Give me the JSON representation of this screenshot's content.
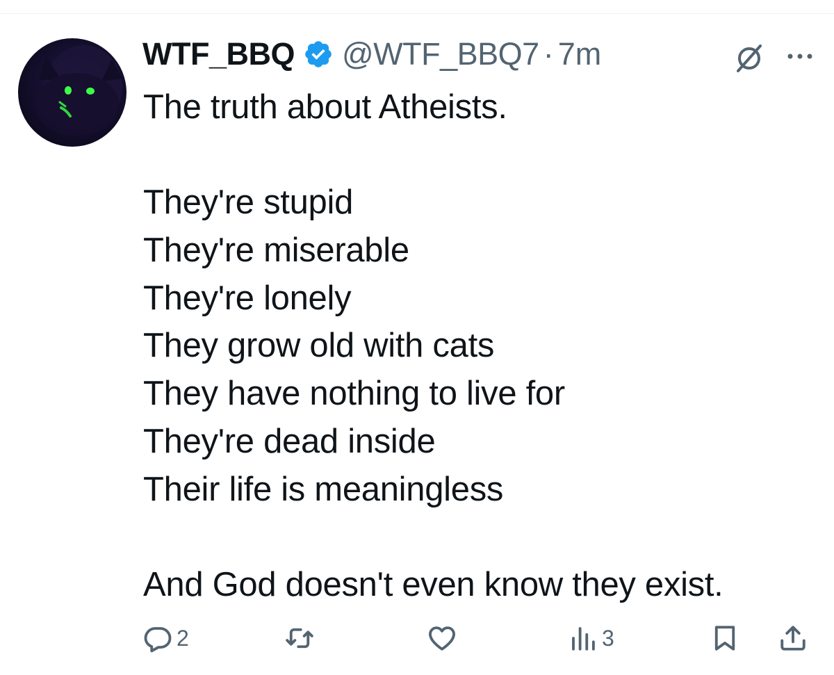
{
  "tweet": {
    "display_name": "WTF_BBQ",
    "handle": "@WTF_BBQ7",
    "separator": "·",
    "time": "7m",
    "verified": true,
    "text_lines": [
      "The truth about Atheists.",
      "",
      "They're stupid",
      "They're miserable",
      "They're lonely",
      "They grow old with cats",
      "They have nothing to live for",
      "They're dead inside",
      "Their life is meaningless",
      "",
      "And God doesn't even know they exist."
    ]
  },
  "actions": {
    "reply_count": "2",
    "retweet_count": "",
    "like_count": "",
    "views_count": "3"
  },
  "icons": {
    "verified": "verified-badge-icon",
    "grok": "grok-icon",
    "more": "more-icon",
    "reply": "reply-icon",
    "retweet": "retweet-icon",
    "like": "heart-icon",
    "views": "views-icon",
    "bookmark": "bookmark-icon",
    "share": "share-icon"
  },
  "colors": {
    "text": "#0f1419",
    "secondary": "#536471",
    "verified": "#1d9bf0",
    "divider": "#eff3f4"
  }
}
